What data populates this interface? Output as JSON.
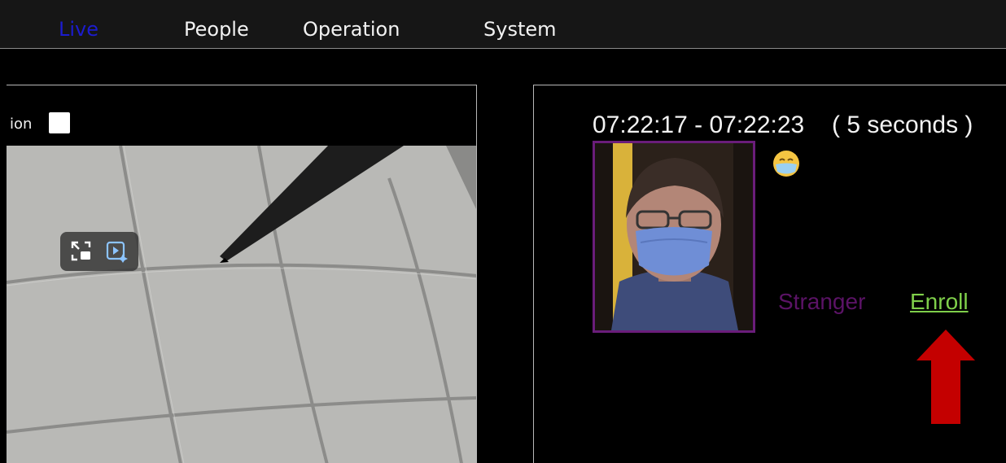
{
  "nav": {
    "items": [
      {
        "label": "Live",
        "active": true
      },
      {
        "label": "People",
        "active": false
      },
      {
        "label": "Operation",
        "active": false
      },
      {
        "label": "System",
        "active": false
      }
    ]
  },
  "left_panel": {
    "option_label_partial": "ion",
    "option_checked": false,
    "overlay_buttons": [
      "exit-fullscreen-icon",
      "ai-video-icon"
    ]
  },
  "event": {
    "time_range": "07:22:17 - 07:22:23",
    "duration": "( 5 seconds )",
    "status_icon": "face-mask-icon",
    "identity_label": "Stranger",
    "enroll_label": "Enroll"
  },
  "colors": {
    "active_nav": "#1c1ccf",
    "face_border": "#6a1d7a",
    "stranger": "#5b1366",
    "enroll": "#7fcf4a",
    "arrow": "#c40000"
  }
}
